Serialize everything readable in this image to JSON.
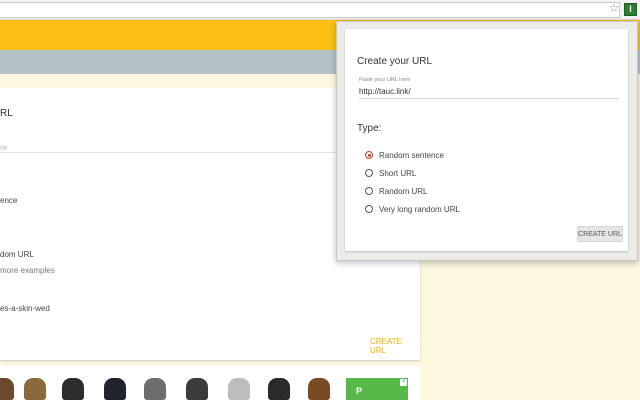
{
  "browser": {
    "star_icon": "☆",
    "extension_icon": "I"
  },
  "page": {
    "card": {
      "title_fragment": "RL",
      "hint_fragment": "re",
      "option_fragment_1": "ence",
      "option_fragment_2": "dom URL",
      "more_examples": "more examples",
      "slug_fragment": "es-a-skin-wed",
      "create_action": "CREATE URL"
    },
    "ad": {
      "text": "P",
      "close_icon": "×"
    }
  },
  "popup": {
    "title": "Create your URL",
    "url_field": {
      "label": "Paste your URL here",
      "value": "http://tauc.link/"
    },
    "type_label": "Type:",
    "options": [
      {
        "label": "Random sentence",
        "selected": true
      },
      {
        "label": "Short URL",
        "selected": false
      },
      {
        "label": "Random URL",
        "selected": false
      },
      {
        "label": "Very long random URL",
        "selected": false
      }
    ],
    "create_button": "CREATE URL"
  },
  "colors": {
    "header_yellow": "#fdbf13",
    "header_gray": "#b3c2c7",
    "accent_yellow": "#f0b400",
    "radio_selected": "#c0392b",
    "extension_green": "#2e7d32"
  }
}
